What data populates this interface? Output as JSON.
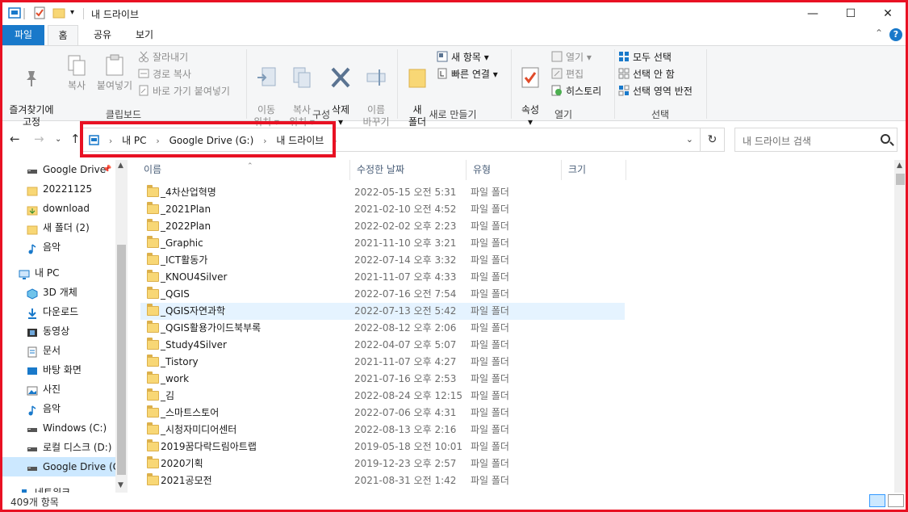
{
  "window": {
    "title": "내 드라이브",
    "minimize": "—",
    "maximize": "☐",
    "close": "✕"
  },
  "ribbon_tabs": [
    "파일",
    "홈",
    "공유",
    "보기"
  ],
  "ribbon": {
    "clipboard": {
      "pin": "즐겨찾기에\n고정",
      "copy": "복사",
      "paste": "붙여넣기",
      "cut": "잘라내기",
      "copy_path": "경로 복사",
      "paste_shortcut": "바로 가기 붙여넣기",
      "label": "클립보드"
    },
    "organize": {
      "move_to": "이동\n위치 ▾",
      "copy_to": "복사\n위치 ▾",
      "delete": "삭제\n▾",
      "rename": "이름\n바꾸기",
      "label": "구성"
    },
    "new": {
      "new_folder": "새\n폴더",
      "new_item": "새 항목 ▾",
      "easy_access": "빠른 연결 ▾",
      "label": "새로 만들기"
    },
    "open": {
      "properties": "속성\n▾",
      "open": "열기 ▾",
      "edit": "편집",
      "history": "히스토리",
      "label": "열기"
    },
    "select": {
      "select_all": "모두 선택",
      "select_none": "선택 안 함",
      "invert": "선택 영역 반전",
      "label": "선택"
    }
  },
  "address": {
    "crumbs": [
      "내 PC",
      "Google Drive (G:)",
      "내 드라이브"
    ],
    "search_placeholder": "내 드라이브 검색"
  },
  "nav_pane": [
    {
      "label": "Google Drive",
      "icon": "drive-icon",
      "pinned": true
    },
    {
      "label": "20221125",
      "icon": "folder-icon"
    },
    {
      "label": "download",
      "icon": "download-folder-icon"
    },
    {
      "label": "새 폴더 (2)",
      "icon": "folder-icon"
    },
    {
      "label": "음악",
      "icon": "music-icon"
    },
    {
      "label": "내 PC",
      "icon": "pc-icon"
    },
    {
      "label": "3D 개체",
      "icon": "3d-objects-icon"
    },
    {
      "label": "다운로드",
      "icon": "downloads-icon"
    },
    {
      "label": "동영상",
      "icon": "videos-icon"
    },
    {
      "label": "문서",
      "icon": "documents-icon"
    },
    {
      "label": "바탕 화면",
      "icon": "desktop-icon"
    },
    {
      "label": "사진",
      "icon": "pictures-icon"
    },
    {
      "label": "음악",
      "icon": "music-icon"
    },
    {
      "label": "Windows (C:)",
      "icon": "drive-icon"
    },
    {
      "label": "로컬 디스크 (D:)",
      "icon": "drive-icon"
    },
    {
      "label": "Google Drive (G:)",
      "icon": "drive-icon",
      "selected": true
    },
    {
      "label": "네트워크",
      "icon": "network-icon"
    }
  ],
  "columns": [
    "이름",
    "수정한 날짜",
    "유형",
    "크기"
  ],
  "files": [
    {
      "name": "_4차산업혁명",
      "date": "2022-05-15 오전 5:31",
      "type": "파일 폴더"
    },
    {
      "name": "_2021Plan",
      "date": "2021-02-10 오전 4:52",
      "type": "파일 폴더"
    },
    {
      "name": "_2022Plan",
      "date": "2022-02-02 오후 2:23",
      "type": "파일 폴더"
    },
    {
      "name": "_Graphic",
      "date": "2021-11-10 오후 3:21",
      "type": "파일 폴더"
    },
    {
      "name": "_ICT활동가",
      "date": "2022-07-14 오후 3:32",
      "type": "파일 폴더"
    },
    {
      "name": "_KNOU4Silver",
      "date": "2021-11-07 오후 4:33",
      "type": "파일 폴더"
    },
    {
      "name": "_QGIS",
      "date": "2022-07-16 오전 7:54",
      "type": "파일 폴더"
    },
    {
      "name": "_QGIS자연과학",
      "date": "2022-07-13 오전 5:42",
      "type": "파일 폴더",
      "hover": true
    },
    {
      "name": "_QGIS활용가이드북부록",
      "date": "2022-08-12 오후 2:06",
      "type": "파일 폴더"
    },
    {
      "name": "_Study4Silver",
      "date": "2022-04-07 오후 5:07",
      "type": "파일 폴더"
    },
    {
      "name": "_Tistory",
      "date": "2021-11-07 오후 4:27",
      "type": "파일 폴더"
    },
    {
      "name": "_work",
      "date": "2021-07-16 오후 2:53",
      "type": "파일 폴더"
    },
    {
      "name": "_김",
      "date": "2022-08-24 오후 12:15",
      "type": "파일 폴더"
    },
    {
      "name": "_스마트스토어",
      "date": "2022-07-06 오후 4:31",
      "type": "파일 폴더"
    },
    {
      "name": "_시청자미디어센터",
      "date": "2022-08-13 오후 2:16",
      "type": "파일 폴더"
    },
    {
      "name": "2019꿈다락드림아트랩",
      "date": "2019-05-18 오전 10:01",
      "type": "파일 폴더"
    },
    {
      "name": "2020기획",
      "date": "2019-12-23 오후 2:57",
      "type": "파일 폴더"
    },
    {
      "name": "2021공모전",
      "date": "2021-08-31 오전 1:42",
      "type": "파일 폴더"
    }
  ],
  "status": {
    "item_count": "409개 항목"
  },
  "colors": {
    "accent": "#1979ca",
    "highlight_box": "#e81123",
    "folder": "#f8d775",
    "selection": "#cce8ff"
  }
}
